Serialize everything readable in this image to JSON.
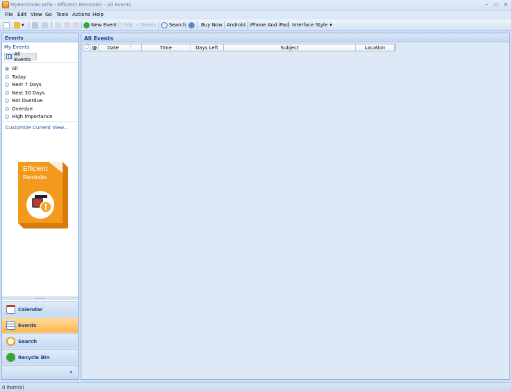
{
  "window": {
    "title": "MyReminder.erfw - Efficient Reminder - All Events"
  },
  "menu": [
    "File",
    "Edit",
    "View",
    "Go",
    "Tools",
    "Actions",
    "Help"
  ],
  "toolbar": {
    "new_event": "New Event",
    "edit": "Edit",
    "delete": "Delete",
    "search": "Search",
    "buy_now": "Buy Now",
    "android": "Android",
    "iphone": "iPhone And iPad",
    "interface_style": "Interface Style"
  },
  "left": {
    "header": "Events",
    "my_events": "My Events",
    "all_events": "All Events",
    "filters": [
      {
        "label": "All",
        "selected": true
      },
      {
        "label": "Today",
        "selected": false
      },
      {
        "label": "Next 7 Days",
        "selected": false
      },
      {
        "label": "Next 30 Days",
        "selected": false
      },
      {
        "label": "Not Overdue",
        "selected": false
      },
      {
        "label": "Overdue",
        "selected": false
      },
      {
        "label": "High Importance",
        "selected": false
      }
    ],
    "customize": "Customize Current View...",
    "box": {
      "line1": "Efficient",
      "line2": "Reminder"
    },
    "nav": [
      {
        "label": "Calendar",
        "icon": "calendar-icon",
        "active": false
      },
      {
        "label": "Events",
        "icon": "events-icon",
        "active": true
      },
      {
        "label": "Search",
        "icon": "search-icon",
        "active": false
      },
      {
        "label": "Recycle Bin",
        "icon": "recycle-bin-icon",
        "active": false
      }
    ]
  },
  "main": {
    "header": "All Events",
    "columns": [
      "Date",
      "Time",
      "Days Left",
      "Subject",
      "Location"
    ]
  },
  "status": {
    "text": "0 Item(s)"
  },
  "colors": {
    "accent": "#15428b",
    "active_nav": "#fcb547",
    "pane_bg": "#dde9f7"
  }
}
